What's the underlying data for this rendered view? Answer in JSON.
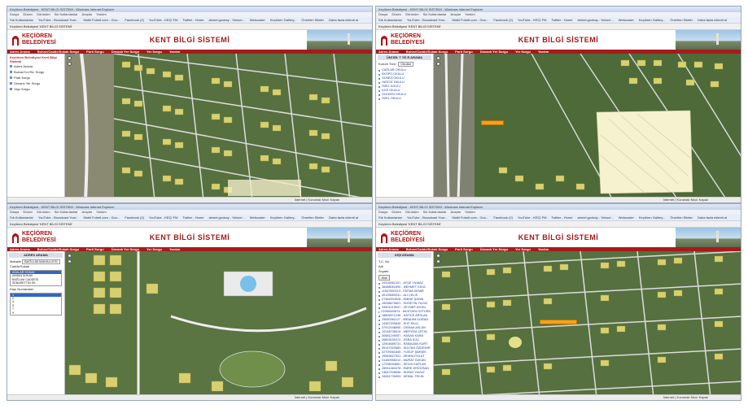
{
  "browser": {
    "window_title": "Keçiören Belediyesi - KENT BİLGİ SİSTEMİ - Windows Internet Explorer",
    "menu": [
      "Dosya",
      "Düzen",
      "Görünüm",
      "Sık Kullanılanlar",
      "Araçlar",
      "Yardım"
    ],
    "favorites": [
      "Sık Kullanılanlar",
      "YouTube - Broadcast Your...",
      "Mobil Fuhetl.com - Gou...",
      "Facebook (2)",
      "YouTube - KEÇİ FM",
      "Twitter - Home",
      "ahmet.govbay - Yahoo!...",
      "Webcuster",
      "Keçiören Gallery...",
      "Önerilen Siteler",
      "Daha fazla eklenti al"
    ],
    "tab": "Keçiören Belediyesi 'KENT BİLGİ SİSTEMİ'",
    "status": "İnternet | Korumalı Mod: Kapalı"
  },
  "site": {
    "logo_line1": "KEÇİÖREN",
    "logo_line2": "BELEDİYESİ",
    "title": "KENT BİLGİ SİSTEMİ",
    "nav": [
      "Adres Arama",
      "Bulvar/Cadde/Sokak Sorgu",
      "Parti Sorgu",
      "Ünvanlı Yer Sorgu",
      "Yer Sorgu",
      "Yardım"
    ]
  },
  "panel1": {
    "header": "Keçiören Belediyesi Kent Bilgi Sistemi",
    "items": [
      "Adres Arama",
      "Bulvar/Cd./Sk. Sorgu",
      "Parti Sorgu",
      "Ünvanlı Yer Sorgu",
      "Yapı Sorgu"
    ]
  },
  "panel2": {
    "title": "ÜNİ BİL T YE R ARAMA",
    "kurum_label": "Kurum Türü :",
    "kurum_value": "Okullar",
    "items": [
      "ÇAĞLAR OKULU",
      "EKSPO OKULU",
      "GÜNEŞ OKULU",
      "HATİCE OKULU",
      "ÖZEL KOLEJ",
      "İLKE OKULU",
      "GÜLDEN OKULU",
      "ÖZEL OKULU"
    ]
  },
  "panel3": {
    "title": "ADRES ARAMA",
    "mahalle_label": "Mahalle",
    "mahalle_value": "BAĞLUM MAHALLESİ",
    "cadde_label": "Cadde/Sokak",
    "streets": [
      "ADALAR SOKAK",
      "ABİDİN SOKAK",
      "BAĞLUM CADDESİ",
      "SEBARETTİN SK."
    ],
    "kapi_label": "Kapı Numaraları",
    "doors": [
      "1",
      "2",
      "3",
      "5",
      "7",
      "9"
    ]
  },
  "panel4": {
    "title": "KİŞİ ARAMA",
    "fields": [
      "T.C. No",
      "Adı",
      "Soyadı"
    ],
    "button": "Ara",
    "results": [
      "19204561201 - AYŞE YILMAZ",
      "36488061890 - MEHMET KAYA",
      "11547890213 - FATMA DEMİR",
      "40125560031 - ALİ ÇELİK",
      "27481904528 - EMİNE ŞAHİN",
      "15098475601 - HÜSEYİN YILDIZ",
      "33501219047 - ZEYNEP AYDIN",
      "21956320874 - MUSTAFA ÖZTÜRK",
      "18804571236 - HATİCE ARSLAN",
      "29650381127 - İBRAHİM DOĞAN",
      "14367209845 - ELİF KILIÇ",
      "37912048650 - OSMAN ASLAN",
      "10248736519 - MERYEM ÇETİN",
      "30681249057 - HASAN KARA",
      "26893150472 - ESRA KOÇ",
      "12504689731 - RAMAZAN KURT",
      "35147920683 - SULTAN ÖZDEMİR",
      "22709361845 - YUSUF ŞİMŞEK",
      "19583627041 - ZEHRA POLAT",
      "31460958212 - MURAT ÖZKAN",
      "17236094851 - SEVGİ KAPLAN",
      "28951360478 - EMRE ERDOĞAN",
      "13647208596 - NURAY YAVUZ",
      "34081726953 - KEMAL TEKİN"
    ]
  }
}
